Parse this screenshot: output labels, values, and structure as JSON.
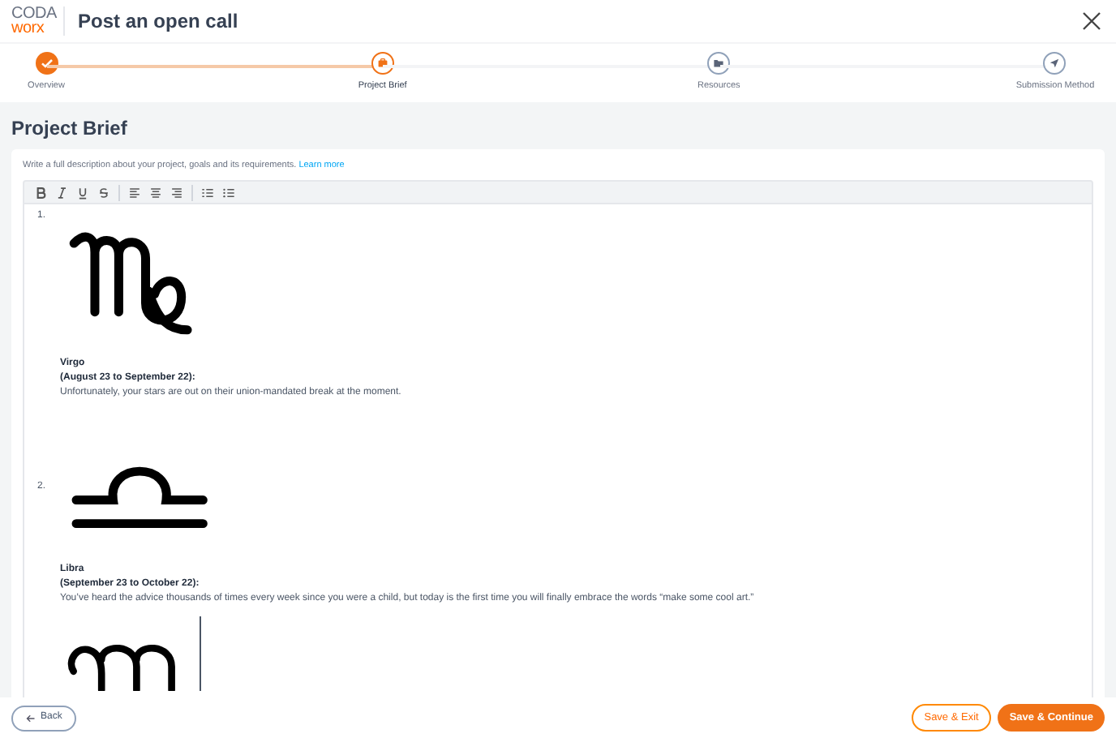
{
  "header": {
    "logo_top": "CODA",
    "logo_bottom": "worx",
    "title": "Post an open call"
  },
  "steps": [
    {
      "label": "Overview",
      "completed": true,
      "selected": false
    },
    {
      "label": "Project Brief",
      "completed": false,
      "selected": true
    },
    {
      "label": "Resources",
      "completed": false,
      "selected": false
    },
    {
      "label": "Submission Method",
      "completed": false,
      "selected": false
    }
  ],
  "section_title": "Project Brief",
  "hint": "Write a full description about your project, goals and its requirements.",
  "hint_link": "Learn more",
  "entries": [
    {
      "number": "1.",
      "name": "Virgo",
      "dates": "(August 23 to September 22):",
      "text": "Unfortunately, your stars are out on their union-mandated break at the moment."
    },
    {
      "number": "2.",
      "name": "Libra",
      "dates": "(September 23 to October 22):",
      "text": "You’ve heard the advice thousands of times every week since you were a child, but today is the first time you will finally embrace the words “make some cool art.”"
    }
  ],
  "footer": {
    "back": "Back",
    "save_exit": "Save & Exit",
    "save_continue": "Save & Continue"
  }
}
